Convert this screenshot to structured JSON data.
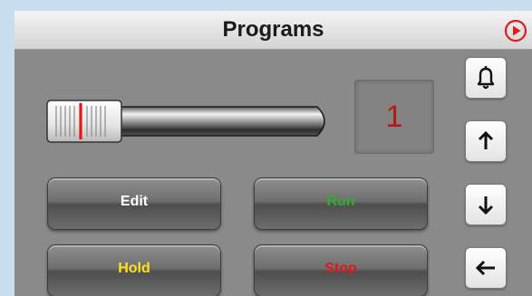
{
  "header": {
    "title": "Programs",
    "play_icon": "play-circle-icon"
  },
  "counter": {
    "value": "1"
  },
  "buttons": [
    {
      "label": "Edit",
      "color": "#ffffff"
    },
    {
      "label": "Run",
      "color": "#33aa33"
    },
    {
      "label": "Hold",
      "color": "#ffe11a"
    },
    {
      "label": "Stop",
      "color": "#dd1a1a"
    }
  ],
  "side_buttons": [
    {
      "icon": "bell-icon"
    },
    {
      "icon": "arrow-up-icon"
    },
    {
      "icon": "arrow-down-icon"
    },
    {
      "icon": "arrow-left-icon"
    }
  ],
  "colors": {
    "panel": "#8a8a8a",
    "outer": "#c9dff0",
    "accent": "#dd1a1a"
  }
}
